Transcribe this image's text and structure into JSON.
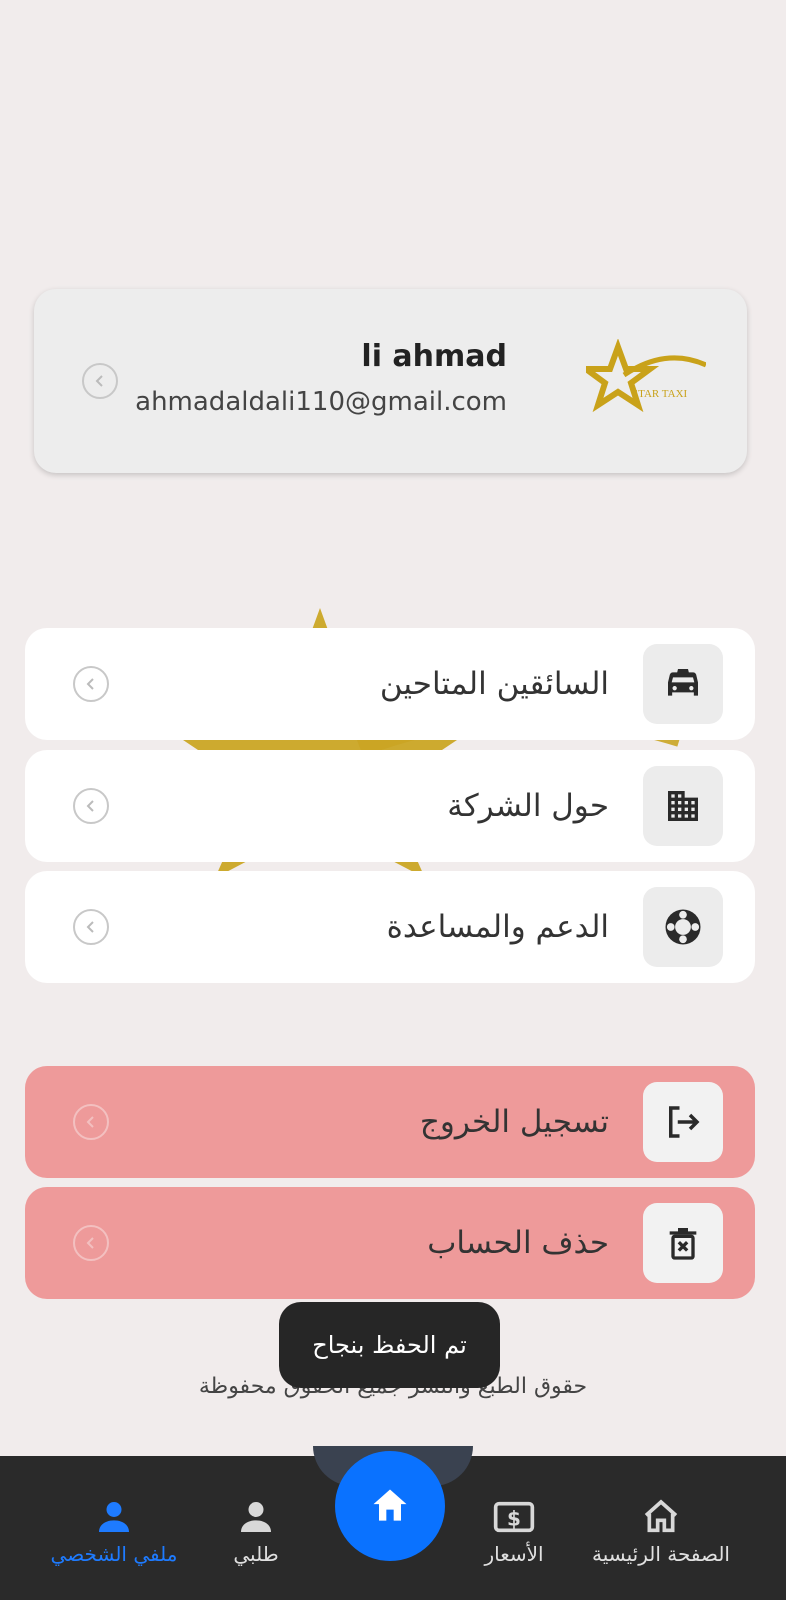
{
  "profile": {
    "name": "li ahmad",
    "email": "ahmadaldali110@gmail.com",
    "logo_text": "STAR TAXI"
  },
  "menu": {
    "items": [
      {
        "label": "السائقين المتاحين",
        "icon": "taxi-icon"
      },
      {
        "label": "حول الشركة",
        "icon": "building-icon"
      },
      {
        "label": "الدعم والمساعدة",
        "icon": "lifebuoy-icon"
      }
    ],
    "danger_items": [
      {
        "label": "تسجيل الخروج",
        "icon": "logout-icon"
      },
      {
        "label": "حذف الحساب",
        "icon": "trash-icon"
      }
    ]
  },
  "toast": "تم الحفظ بنجاح",
  "footer": "حقوق الطبع والنشر جميع الحقوق محفوظة",
  "bottom_nav": {
    "items": [
      {
        "label": "ملفي الشخصي",
        "icon": "person-icon",
        "active": true
      },
      {
        "label": "طلبي",
        "icon": "person-outline-icon"
      },
      {
        "label": "الأسعار",
        "icon": "price-tag-icon"
      },
      {
        "label": "الصفحة الرئيسية",
        "icon": "home-outline-icon"
      }
    ],
    "center_icon": "home-icon"
  },
  "colors": {
    "accent": "#0a72ff",
    "danger": "#ee9a9a",
    "gold": "#c9a21a",
    "nav_bg": "#2a2a2a"
  }
}
